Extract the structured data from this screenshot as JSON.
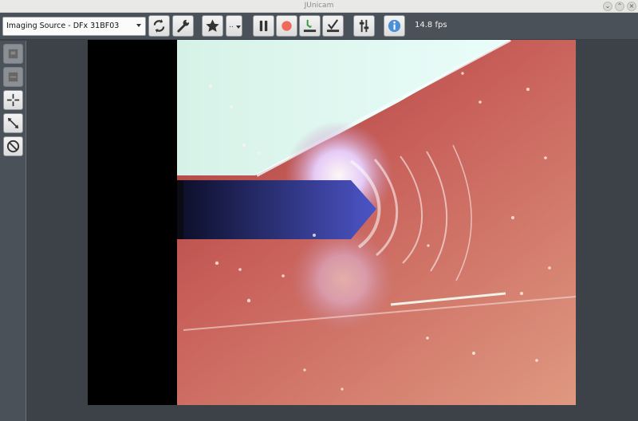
{
  "window": {
    "title": "JUnicam"
  },
  "toolbar": {
    "source_select": "Imaging Source - DFx 31BF03",
    "preset_label": "..",
    "fps": "14.8 fps"
  },
  "icons": {
    "refresh": "refresh-icon",
    "settings": "wrench-icon",
    "favorite": "star-icon",
    "pause": "pause-icon",
    "record": "record-icon",
    "snapshot": "snapshot-icon",
    "calibrate": "calibrate-icon",
    "adjust": "sliders-icon",
    "info": "info-icon"
  },
  "colors": {
    "record": "#ef6a5d",
    "info": "#4a8fd8",
    "snapshot_accent": "#2f9a3c"
  }
}
